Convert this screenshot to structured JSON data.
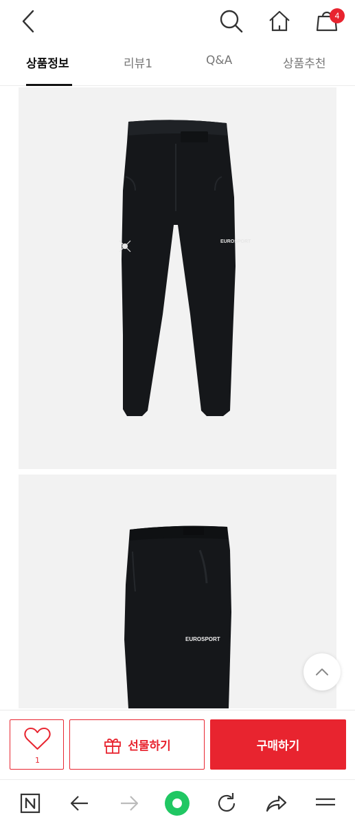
{
  "colors": {
    "accent": "#e8242f",
    "panel_background": "#f2f2f2",
    "active_tab": "#111111",
    "browser_dot": "#20c763"
  },
  "header": {
    "icons": [
      "back-arrow-icon",
      "search-icon",
      "home-icon",
      "shopping-bag-icon"
    ],
    "cart_count": "4"
  },
  "tabs": [
    {
      "label": "상품정보",
      "active": true
    },
    {
      "label": "리뷰1",
      "active": false
    },
    {
      "label": "Q&A",
      "active": false
    },
    {
      "label": "상품추천",
      "active": false
    }
  ],
  "product_images": [
    {
      "logo_text": "EUROSPORT"
    },
    {
      "logo_text": "EUROSPORT"
    }
  ],
  "buy_bar": {
    "wishlist_count": "1",
    "gift_label": "선물하기",
    "buy_label": "구매하기"
  },
  "browser_nav": {
    "icons": [
      "naver-n-icon",
      "back-icon",
      "forward-icon",
      "green-dot-icon",
      "reload-icon",
      "share-icon",
      "menu-icon"
    ]
  }
}
